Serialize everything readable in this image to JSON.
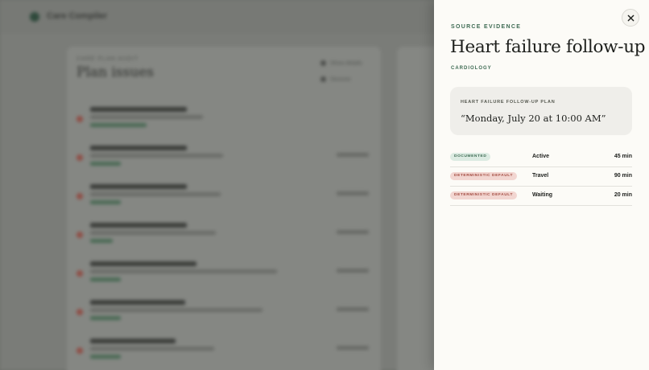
{
  "background": {
    "app_name": "Care Compiler",
    "card_kicker": "CARE PLAN AUDIT",
    "card_title": "Plan issues",
    "controls": [
      "Show details",
      "Sources"
    ],
    "rows": [
      {
        "w1": 120,
        "w2": 140,
        "w3": 70
      },
      {
        "w1": 120,
        "w2": 165,
        "w3": 38
      },
      {
        "w1": 120,
        "w2": 162,
        "w3": 38
      },
      {
        "w1": 120,
        "w2": 156,
        "w3": 28
      },
      {
        "w1": 132,
        "w2": 232,
        "w3": 38
      },
      {
        "w1": 118,
        "w2": 214,
        "w3": 38
      },
      {
        "w1": 106,
        "w2": 154,
        "w3": 38
      }
    ]
  },
  "panel": {
    "eyebrow": "SOURCE EVIDENCE",
    "title": "Heart failure follow-up",
    "specialty": "CARDIOLOGY",
    "quote": {
      "label": "HEART FAILURE FOLLOW-UP PLAN",
      "text": "“Monday, July 20 at 10:00 AM”"
    },
    "evidence": [
      {
        "badge": "DOCUMENTED",
        "badge_type": "documented",
        "phase": "Active",
        "duration": "45 min"
      },
      {
        "badge": "DETERMINISTIC DEFAULT",
        "badge_type": "default",
        "phase": "Travel",
        "duration": "90 min"
      },
      {
        "badge": "DETERMINISTIC DEFAULT",
        "badge_type": "default",
        "phase": "Waiting",
        "duration": "20 min"
      }
    ]
  },
  "colors": {
    "accent_green": "#3d6a52",
    "default_red": "#a24a3f",
    "panel_bg": "#fcfbf7"
  },
  "icons": {
    "close": "close-icon"
  }
}
